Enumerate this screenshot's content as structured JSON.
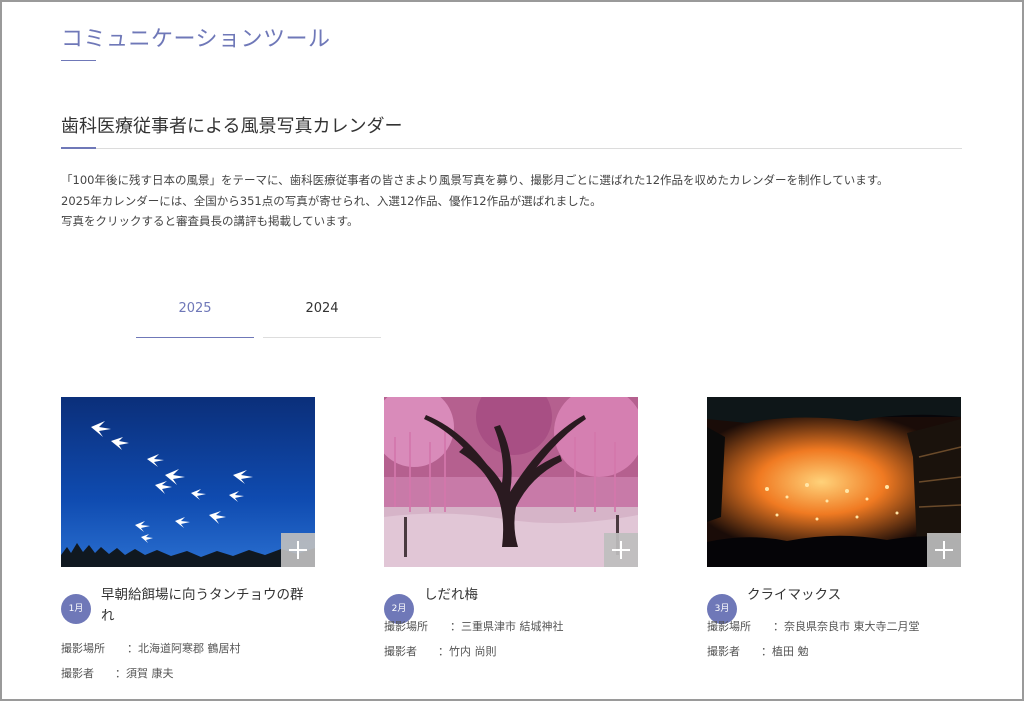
{
  "section": {
    "title": "コミュニケーションツール"
  },
  "calendar": {
    "title": "歯科医療従事者による風景写真カレンダー",
    "intro": [
      "「100年後に残す日本の風景」をテーマに、歯科医療従事者の皆さまより風景写真を募り、撮影月ごとに選ばれた12作品を収めたカレンダーを制作しています。",
      "2025年カレンダーには、全国から351点の写真が寄せられ、入選12作品、優作12作品が選ばれました。",
      "写真をクリックすると審査員長の講評も掲載しています。"
    ]
  },
  "tabs": [
    {
      "label": "2025",
      "active": true
    },
    {
      "label": "2024",
      "active": false
    }
  ],
  "cards": [
    {
      "month": "1月",
      "title": "早朝給餌場に向うタンチョウの群れ",
      "place_label": "撮影場所",
      "place": "：北海道阿寒郡 鶴居村",
      "photographer_label": "撮影者",
      "photographer": "：須賀 康夫",
      "image_icon": "cranes-photo"
    },
    {
      "month": "2月",
      "title": "しだれ梅",
      "place_label": "撮影場所",
      "place": "：三重県津市 結城神社",
      "photographer_label": "撮影者",
      "photographer": "：竹内 尚則",
      "image_icon": "plum-tree-photo"
    },
    {
      "month": "3月",
      "title": "クライマックス",
      "place_label": "撮影場所",
      "place": "：奈良県奈良市 東大寺二月堂",
      "photographer_label": "撮影者",
      "photographer": "：植田 勉",
      "image_icon": "fire-festival-photo"
    }
  ],
  "colors": {
    "accent": "#6f78b8",
    "plus_button": "#bebebe"
  }
}
